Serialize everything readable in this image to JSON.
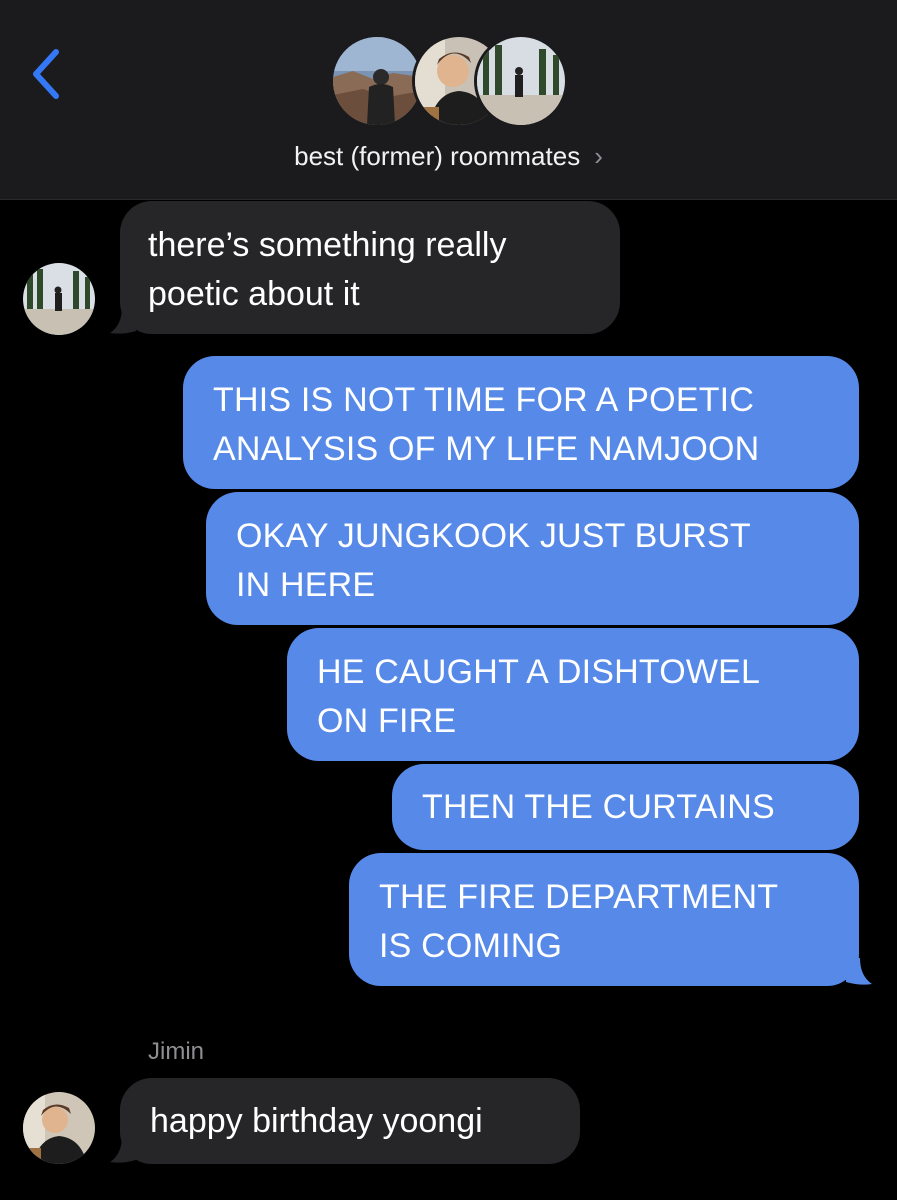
{
  "header": {
    "back_icon": "chevron-left-icon",
    "group_name": "best (former) roommates",
    "chevron": "›",
    "accent": "#3478f6"
  },
  "messages": [
    {
      "type": "received",
      "text_lines": [
        "there’s something really",
        "poetic about it"
      ]
    },
    {
      "type": "sent",
      "text_lines": [
        "THIS IS NOT TIME FOR A POETIC",
        "ANALYSIS OF MY LIFE NAMJOON"
      ]
    },
    {
      "type": "sent",
      "text_lines": [
        "OKAY JUNGKOOK JUST BURST",
        "IN HERE"
      ]
    },
    {
      "type": "sent",
      "text_lines": [
        "HE CAUGHT A DISHTOWEL",
        "ON FIRE"
      ]
    },
    {
      "type": "sent",
      "text_lines": [
        "THEN THE CURTAINS"
      ]
    },
    {
      "type": "sent",
      "text_lines": [
        "THE FIRE DEPARTMENT",
        "IS COMING"
      ]
    },
    {
      "type": "received",
      "sender": "Jimin",
      "text_lines": [
        "happy birthday yoongi"
      ]
    }
  ],
  "colors": {
    "sent_bubble": "#5689e8",
    "received_bubble": "#262629",
    "header_bg": "#1b1b1d"
  }
}
